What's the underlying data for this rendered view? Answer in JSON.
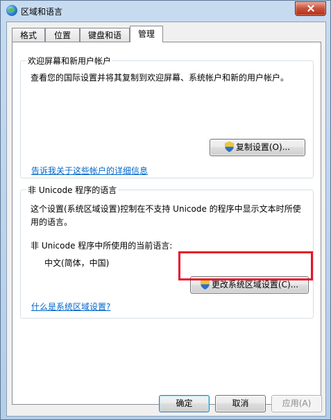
{
  "window": {
    "title": "区域和语言"
  },
  "tabs": [
    {
      "label": "格式"
    },
    {
      "label": "位置"
    },
    {
      "label": "键盘和语言"
    },
    {
      "label": "管理",
      "active": true
    }
  ],
  "welcome_group": {
    "legend": "欢迎屏幕和新用户帐户",
    "description": "查看您的国际设置并将其复制到欢迎屏幕、系统帐户和新的用户帐户。",
    "copy_button": "复制设置(O)...",
    "link": "告诉我关于这些帐户的详细信息"
  },
  "unicode_group": {
    "legend": "非 Unicode 程序的语言",
    "description_line1": "这个设置(系统区域设置)控制在不支持 Unicode 的程序中显示文本时所使",
    "description_line2": "用的语言。",
    "current_label": "非 Unicode 程序中所使用的当前语言:",
    "current_value": "中文(简体，中国)",
    "change_button": "更改系统区域设置(C)...",
    "link": "什么是系统区域设置?"
  },
  "footer": {
    "ok": "确定",
    "cancel": "取消",
    "apply": "应用(A)"
  },
  "colors": {
    "highlight": "#e8122a",
    "link": "#0066cc"
  },
  "icons": {
    "app": "globe-icon",
    "uac": "shield-icon",
    "close": "close-icon"
  }
}
